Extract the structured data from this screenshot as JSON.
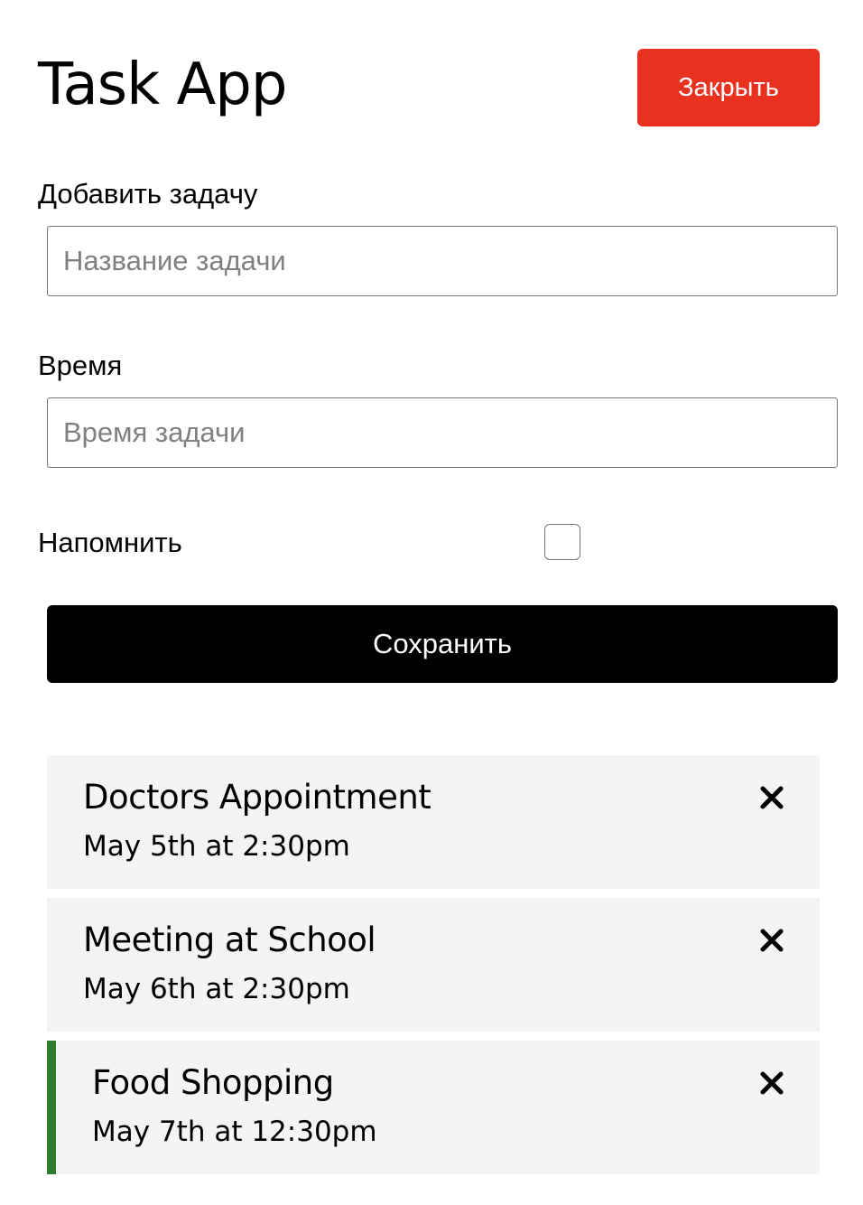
{
  "app": {
    "title": "Task App",
    "close_label": "Закрыть",
    "colors": {
      "close_button": "#e8311f",
      "save_button": "#000000",
      "reminder_accent": "#2e7d2e",
      "task_background": "#f4f4f4"
    }
  },
  "form": {
    "task_label": "Добавить задачу",
    "task_placeholder": "Название задачи",
    "task_value": "",
    "time_label": "Время",
    "time_placeholder": "Время задачи",
    "time_value": "",
    "reminder_label": "Напомнить",
    "reminder_checked": false,
    "save_label": "Сохранить"
  },
  "tasks": [
    {
      "text": "Doctors Appointment",
      "day": "May 5th at 2:30pm",
      "reminder": false,
      "delete_icon": "close-icon"
    },
    {
      "text": "Meeting at School",
      "day": "May 6th at 2:30pm",
      "reminder": false,
      "delete_icon": "close-icon"
    },
    {
      "text": "Food Shopping",
      "day": "May 7th at 12:30pm",
      "reminder": true,
      "delete_icon": "close-icon"
    }
  ]
}
